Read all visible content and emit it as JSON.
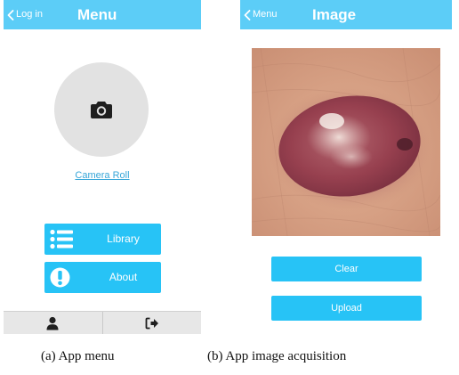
{
  "menu_screen": {
    "back_label": "Log in",
    "title": "Menu",
    "camera_roll_label": "Camera Roll",
    "buttons": [
      {
        "label": "Library",
        "icon": "list-icon"
      },
      {
        "label": "About",
        "icon": "exclamation-icon"
      }
    ],
    "tabbar": [
      {
        "icon": "user-icon"
      },
      {
        "icon": "sign-out-icon"
      }
    ]
  },
  "image_screen": {
    "back_label": "Menu",
    "title": "Image",
    "photo_subject": "skin lesion photo",
    "clear_label": "Clear",
    "upload_label": "Upload"
  },
  "captions": {
    "a": "(a) App menu",
    "b": "(b) App image acquisition"
  },
  "colors": {
    "navbar": "#5ccdf7",
    "button": "#27c3f6",
    "link": "#37a6d8",
    "camera_circle": "#e2e2e2",
    "tabbar": "#e7e7e7"
  }
}
